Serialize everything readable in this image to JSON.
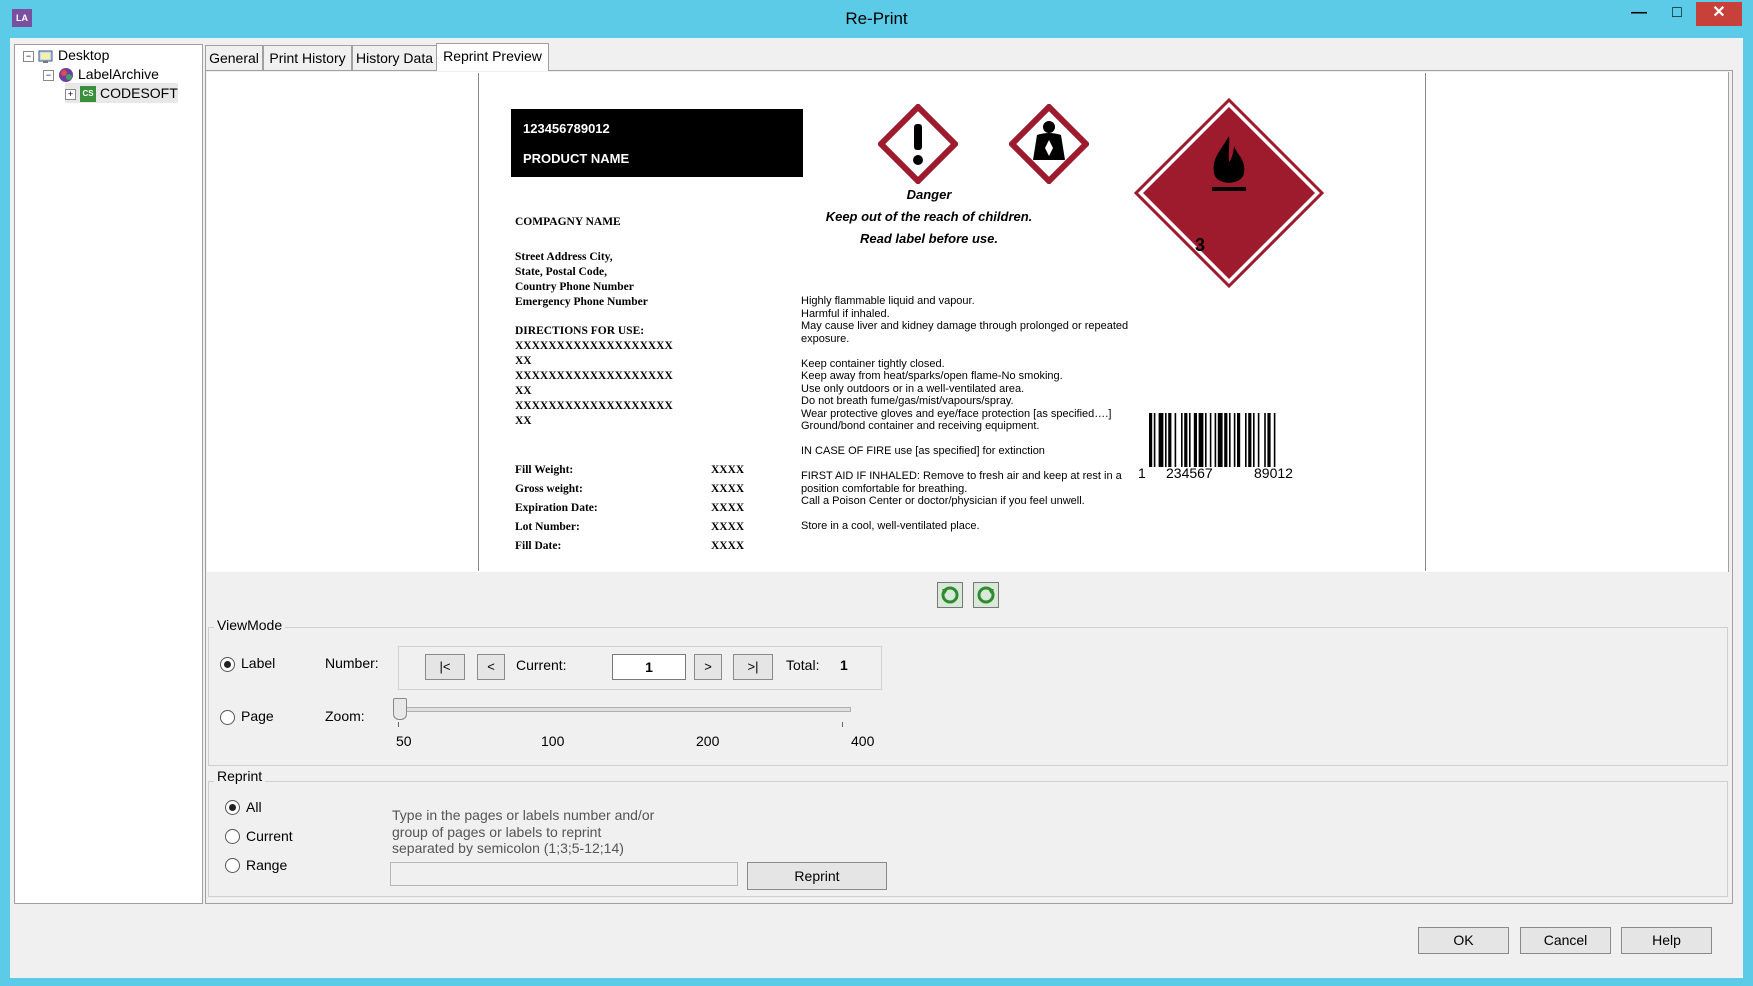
{
  "window": {
    "title": "Re-Print",
    "app_icon": "LA"
  },
  "tree": [
    {
      "label": "Desktop",
      "expander": "−"
    },
    {
      "label": "LabelArchive",
      "expander": "−"
    },
    {
      "label": "CODESOFT",
      "expander": "+",
      "badge": "CS"
    }
  ],
  "tabs": [
    "General",
    "Print History",
    "History Data",
    "Reprint Preview"
  ],
  "active_tab": "Reprint Preview",
  "label": {
    "code": "123456789012",
    "product_name": "PRODUCT NAME",
    "company": "COMPAGNY NAME",
    "address": [
      "Street Address City,",
      "State, Postal Code,",
      "Country Phone Number",
      "Emergency Phone Number"
    ],
    "directions_title": "DIRECTIONS FOR USE:",
    "directions": [
      "XXXXXXXXXXXXXXXXXXX",
      "XX",
      "XXXXXXXXXXXXXXXXXXX",
      "XX",
      "XXXXXXXXXXXXXXXXXXX",
      "XX"
    ],
    "fields": [
      {
        "name": "Fill Weight:",
        "value": "XXXX"
      },
      {
        "name": "Gross weight:",
        "value": "XXXX"
      },
      {
        "name": "Expiration Date:",
        "value": "XXXX"
      },
      {
        "name": "Lot Number:",
        "value": "XXXX"
      },
      {
        "name": "Fill Date:",
        "value": "XXXX"
      }
    ],
    "danger": "Danger",
    "warning1": "Keep out of the reach of children.",
    "warning2": "Read label before use.",
    "diamond_number": "3",
    "hazard_color": "#9e1b2e",
    "statements": [
      "Highly flammable liquid and vapour.",
      "Harmful if inhaled.",
      "May cause liver and kidney damage through prolonged or repeated",
      "exposure.",
      "",
      "Keep container tightly closed.",
      "Keep away from heat/sparks/open flame-No smoking.",
      "Use only outdoors or in a well-ventilated area.",
      "Do not breath fume/gas/mist/vapours/spray.",
      "Wear protective gloves and eye/face protection [as specified….]",
      "Ground/bond container and receiving equipment.",
      "",
      "IN CASE OF FIRE use [as specified] for extinction",
      "",
      "FIRST AID IF INHALED: Remove to fresh air and keep at rest in a",
      "position comfortable for breathing.",
      "Call a Poison Center or doctor/physician if you feel unwell.",
      "",
      "Store in a cool, well-ventilated place."
    ],
    "barcode": {
      "d1": "1",
      "d2": "234567",
      "d3": "89012"
    }
  },
  "viewmode": {
    "title": "ViewMode",
    "label_option": "Label",
    "page_option": "Page",
    "selected": "Label",
    "number_label": "Number:",
    "first": "|<",
    "prev": "<",
    "current_label": "Current:",
    "current_value": "1",
    "next": ">",
    "last": ">|",
    "total_label": "Total:",
    "total_value": "1",
    "zoom_label": "Zoom:",
    "zoom_ticks": [
      "50",
      "100",
      "200",
      "400"
    ],
    "zoom_value": 50
  },
  "reprint": {
    "title": "Reprint",
    "options": [
      "All",
      "Current",
      "Range"
    ],
    "selected": "All",
    "hint": [
      "Type in the pages or labels number and/or",
      "group of pages or labels to reprint",
      "separated by semicolon (1;3;5-12;14)"
    ],
    "range_value": "",
    "button": "Reprint"
  },
  "footer": {
    "ok": "OK",
    "cancel": "Cancel",
    "help": "Help"
  }
}
